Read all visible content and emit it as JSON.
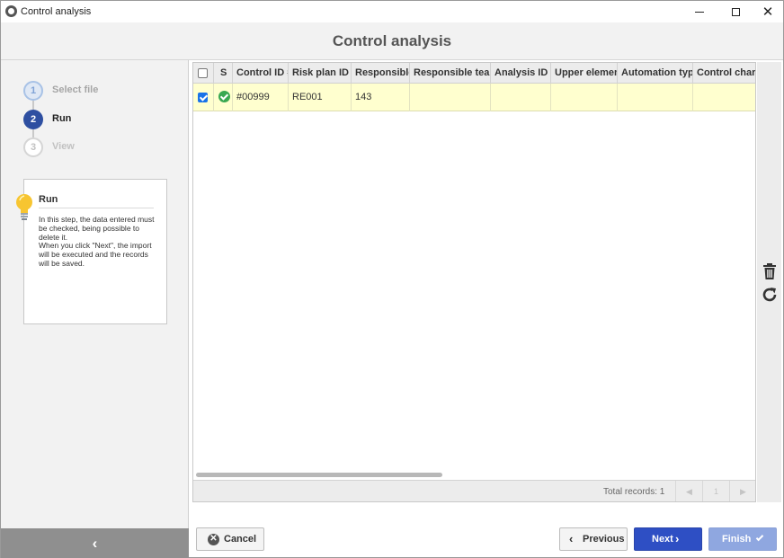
{
  "window": {
    "title": "Control analysis"
  },
  "header": {
    "title": "Control analysis"
  },
  "steps": [
    {
      "number": "1",
      "label": "Select file",
      "state": "done"
    },
    {
      "number": "2",
      "label": "Run",
      "state": "active"
    },
    {
      "number": "3",
      "label": "View",
      "state": "pending"
    }
  ],
  "help": {
    "title": "Run",
    "text": "In this step, the data entered must be checked, being possible to delete it.\nWhen you click \"Next\", the import will be executed and the records will be saved.",
    "icon": "lightbulb-icon"
  },
  "grid": {
    "columns": [
      "S",
      "Control ID #",
      "Risk plan ID #",
      "Responsible",
      "Responsible team",
      "Analysis ID #",
      "Upper element",
      "Automation type",
      "Control charact"
    ],
    "rows": [
      {
        "checked": true,
        "status": "valid",
        "control_id": "#00999",
        "risk_plan_id": "RE001",
        "responsible": "143",
        "responsible_team": "",
        "analysis_id": "",
        "upper_element": "",
        "automation_type": "",
        "control_charact": ""
      }
    ],
    "footer": {
      "total_label": "Total records: 1",
      "page": "1"
    }
  },
  "tools": {
    "delete_icon": "trash-icon",
    "refresh_icon": "refresh-icon"
  },
  "buttons": {
    "cancel": "Cancel",
    "previous": "Previous",
    "next": "Next",
    "finish": "Finish"
  },
  "colors": {
    "primary": "#2e4fc4",
    "disabled_primary": "#8fa7e0",
    "row_highlight": "#ffffcf",
    "success": "#39a851"
  }
}
